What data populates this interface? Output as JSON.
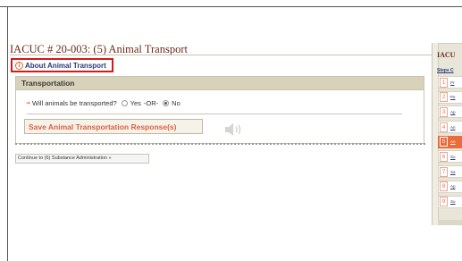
{
  "page": {
    "title": "IACUC # 20-003: (5) Animal Transport"
  },
  "about": {
    "icon": "info-icon",
    "link_label": "About Animal Transport"
  },
  "transport_panel": {
    "header": "Transportation",
    "question": "Will animals be transported?",
    "options": [
      "Yes",
      "-OR-",
      "No"
    ],
    "selected": "No",
    "save_label": "Save Animal Transportation Response(s)"
  },
  "speaker": {
    "icon": "speaker-icon"
  },
  "continue_label": "Continue to (6) Substance Administration »",
  "sidebar": {
    "title": "IACU",
    "steps_label": "Steps C",
    "items": [
      {
        "num": "1",
        "label": "Pr"
      },
      {
        "num": "2",
        "label": "Pe"
      },
      {
        "num": "3",
        "label": "Ap"
      },
      {
        "num": "4",
        "label": "An"
      },
      {
        "num": "5",
        "label": "An",
        "active": true
      },
      {
        "num": "6",
        "label": "Su"
      },
      {
        "num": "7",
        "label": "Sa"
      },
      {
        "num": "8",
        "label": "Ap"
      },
      {
        "num": "9",
        "label": "Su"
      }
    ]
  },
  "colors": {
    "title": "#6b2a1a",
    "accent": "#ef6a3a",
    "link": "#2a3a78",
    "highlight_border": "#d11a1a",
    "panel_header": "#d7d2b9"
  }
}
